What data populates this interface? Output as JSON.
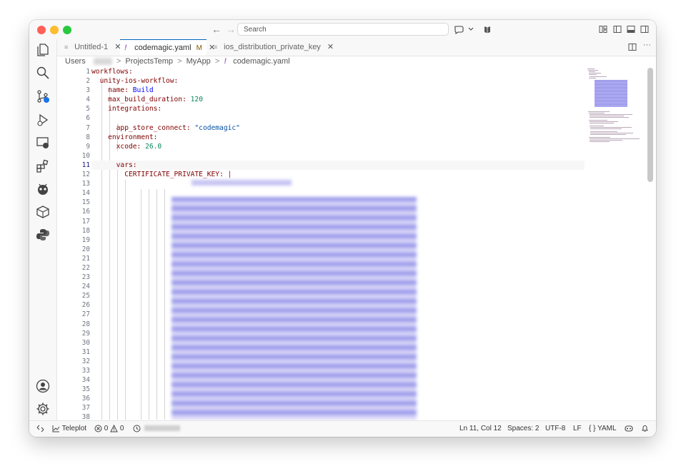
{
  "titlebar": {
    "search_placeholder": "Search"
  },
  "tabs": [
    {
      "label": "Untitled-1",
      "icon": "file-lines-icon",
      "active": false,
      "modified": ""
    },
    {
      "label": "codemagic.yaml",
      "icon": "yaml-icon",
      "active": true,
      "modified": "M"
    },
    {
      "label": "ios_distribution_private_key",
      "icon": "file-lines-icon",
      "active": false,
      "modified": ""
    }
  ],
  "tab_icons": {
    "yaml": "!",
    "close": "✕",
    "file": "≡"
  },
  "breadcrumb": {
    "items": [
      "Users",
      "ProjectsTemp",
      "MyApp",
      "codemagic.yaml"
    ],
    "separator": ">"
  },
  "editor": {
    "line_numbers": [
      "1",
      "2",
      "3",
      "4",
      "5",
      "6",
      "7",
      "8",
      "9",
      "10",
      "11",
      "12",
      "13",
      "14",
      "15",
      "16",
      "17",
      "18",
      "19",
      "20",
      "21",
      "22",
      "23",
      "24",
      "25",
      "26",
      "27",
      "28",
      "29",
      "30",
      "31",
      "32",
      "33",
      "34",
      "35",
      "36",
      "37",
      "38"
    ],
    "current_line": 11,
    "code": {
      "l1": "workflows:",
      "l2_key": "unity-ios-workflow:",
      "l3_key": "name:",
      "l3_val": "Build",
      "l4_key": "max_build_duration:",
      "l4_val": "120",
      "l5_key": "integrations:",
      "l7_key": "app_store_connect:",
      "l7_val": "\"codemagic\"",
      "l8_key": "environment:",
      "l9_key": "xcode:",
      "l9_val": "26.0",
      "l11_key": "vars:",
      "l12_key": "CERTIFICATE_PRIVATE_KEY:",
      "l12_val": "|"
    }
  },
  "statusbar": {
    "teleplot": "Teleplot",
    "errors": "0",
    "warnings": "0",
    "cursor": "Ln 11, Col 12",
    "spaces": "Spaces: 2",
    "encoding": "UTF-8",
    "eol": "LF",
    "language_icon": "{ }",
    "language": "YAML"
  },
  "colors": {
    "accent": "#0066bf",
    "yaml_key": "#800000",
    "string": "#0451a5",
    "number": "#098658"
  }
}
